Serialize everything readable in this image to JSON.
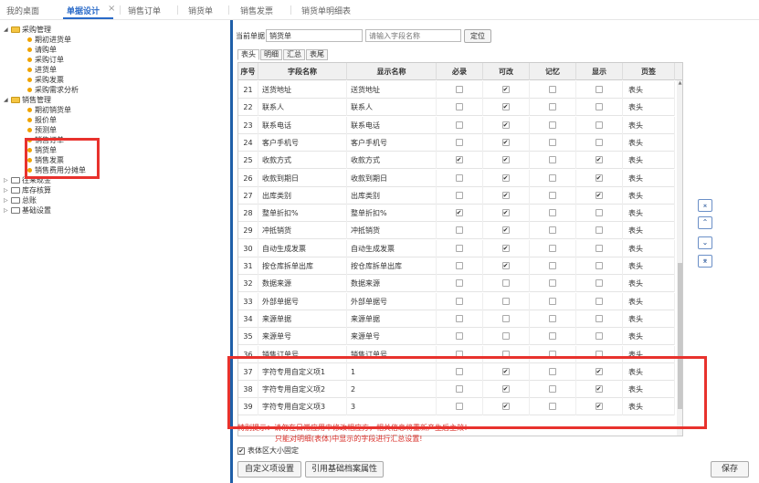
{
  "top_tabs": {
    "desktop": "我的桌面",
    "doc_design": "单据设计",
    "close": "×",
    "sales_order": "销售订单",
    "sales_doc": "销货单",
    "sales_invoice": "销售发票",
    "sales_detail": "销货单明细表"
  },
  "tree": {
    "purchase": "采购管理",
    "purchase_items": [
      "期初进货单",
      "请购单",
      "采购订单",
      "进货单",
      "采购发票",
      "采购需求分析"
    ],
    "sales": "销售管理",
    "sales_items": [
      "期初销货单",
      "报价单",
      "预测单",
      "销售订单",
      "销货单",
      "销售发票",
      "销售费用分摊单"
    ],
    "others": [
      "往来现金",
      "库存核算",
      "总账",
      "基础设置"
    ]
  },
  "form": {
    "current_doc_label": "当前单据",
    "current_doc_value": "销货单",
    "field_placeholder": "请输入字段名称",
    "locate_button": "定位"
  },
  "subtabs": [
    "表头",
    "明细",
    "汇总",
    "表尾"
  ],
  "grid": {
    "columns": [
      "序号",
      "字段名称",
      "显示名称",
      "必录",
      "可改",
      "记忆",
      "显示",
      "页签"
    ],
    "rows": [
      {
        "no": "21",
        "field": "送货地址",
        "display": "送货地址",
        "required": false,
        "editable": true,
        "memory": false,
        "show": false,
        "tab": "表头"
      },
      {
        "no": "22",
        "field": "联系人",
        "display": "联系人",
        "required": false,
        "editable": true,
        "memory": false,
        "show": false,
        "tab": "表头"
      },
      {
        "no": "23",
        "field": "联系电话",
        "display": "联系电话",
        "required": false,
        "editable": true,
        "memory": false,
        "show": false,
        "tab": "表头"
      },
      {
        "no": "24",
        "field": "客户手机号",
        "display": "客户手机号",
        "required": false,
        "editable": true,
        "memory": false,
        "show": false,
        "tab": "表头"
      },
      {
        "no": "25",
        "field": "收款方式",
        "display": "收款方式",
        "required": true,
        "editable": true,
        "memory": false,
        "show": true,
        "tab": "表头"
      },
      {
        "no": "26",
        "field": "收款到期日",
        "display": "收款到期日",
        "required": false,
        "editable": true,
        "memory": false,
        "show": true,
        "tab": "表头"
      },
      {
        "no": "27",
        "field": "出库类别",
        "display": "出库类别",
        "required": false,
        "editable": true,
        "memory": false,
        "show": true,
        "tab": "表头"
      },
      {
        "no": "28",
        "field": "整单折扣%",
        "display": "整单折扣%",
        "required": true,
        "editable": true,
        "memory": false,
        "show": false,
        "tab": "表头"
      },
      {
        "no": "29",
        "field": "冲抵销货",
        "display": "冲抵销货",
        "required": false,
        "editable": true,
        "memory": false,
        "show": false,
        "tab": "表头"
      },
      {
        "no": "30",
        "field": "自动生成发票",
        "display": "自动生成发票",
        "required": false,
        "editable": true,
        "memory": false,
        "show": false,
        "tab": "表头"
      },
      {
        "no": "31",
        "field": "按仓库拆单出库",
        "display": "按仓库拆单出库",
        "required": false,
        "editable": true,
        "memory": false,
        "show": false,
        "tab": "表头"
      },
      {
        "no": "32",
        "field": "数据来源",
        "display": "数据来源",
        "required": false,
        "editable": false,
        "memory": false,
        "show": false,
        "tab": "表头"
      },
      {
        "no": "33",
        "field": "外部单据号",
        "display": "外部单据号",
        "required": false,
        "editable": false,
        "memory": false,
        "show": false,
        "tab": "表头"
      },
      {
        "no": "34",
        "field": "来源单据",
        "display": "来源单据",
        "required": false,
        "editable": false,
        "memory": false,
        "show": false,
        "tab": "表头"
      },
      {
        "no": "35",
        "field": "来源单号",
        "display": "来源单号",
        "required": false,
        "editable": false,
        "memory": false,
        "show": false,
        "tab": "表头"
      },
      {
        "no": "36",
        "field": "销售订单号",
        "display": "销售订单号",
        "required": false,
        "editable": false,
        "memory": false,
        "show": false,
        "tab": "表头"
      },
      {
        "no": "37",
        "field": "字符专用自定义项1",
        "display": "1",
        "required": false,
        "editable": true,
        "memory": false,
        "show": true,
        "tab": "表头"
      },
      {
        "no": "38",
        "field": "字符专用自定义项2",
        "display": "2",
        "required": false,
        "editable": true,
        "memory": false,
        "show": true,
        "tab": "表头"
      },
      {
        "no": "39",
        "field": "字符专用自定义项3",
        "display": "3",
        "required": false,
        "editable": true,
        "memory": false,
        "show": true,
        "tab": "表头"
      }
    ]
  },
  "hints": {
    "line1": "特别提示：请勿在日常应用中修改相应方，相关信息将重新产生后主效！",
    "line2": "只能对明细(表体)中显示的字段进行汇总设置!"
  },
  "fixed_size_label": "表体区大小固定",
  "buttons": {
    "custom_items": "自定义项设置",
    "ref_archive": "引用基础档案属性",
    "save": "保存"
  },
  "side_buttons": [
    "⌅",
    "⌃",
    "⌄",
    "⌆"
  ],
  "colors": {
    "accent": "#2a6ac8",
    "highlight_red": "#e8322d",
    "splitter": "#1f5fa8"
  }
}
